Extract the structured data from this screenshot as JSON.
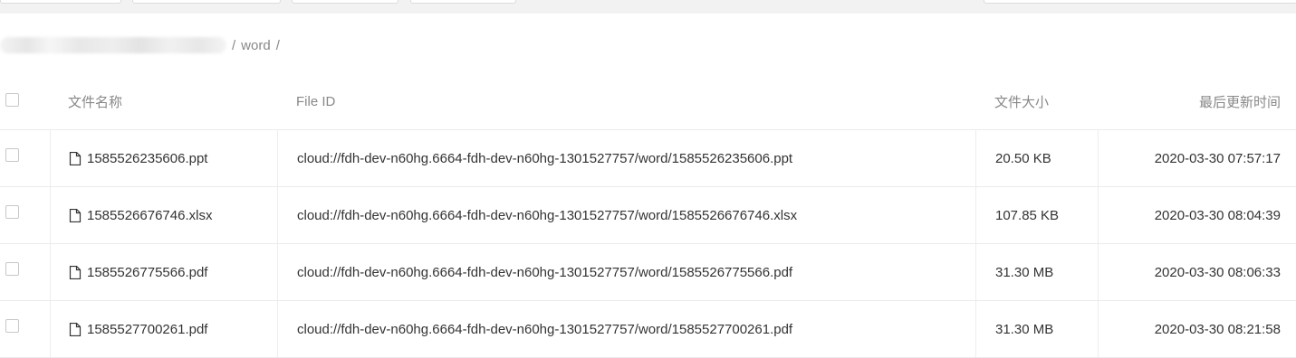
{
  "breadcrumb": {
    "separator": "/",
    "current": "word"
  },
  "table": {
    "columns": {
      "name": "文件名称",
      "id": "File ID",
      "size": "文件大小",
      "time": "最后更新时间"
    },
    "rows": [
      {
        "name": "1585526235606.ppt",
        "id": "cloud://fdh-dev-n60hg.6664-fdh-dev-n60hg-1301527757/word/1585526235606.ppt",
        "size": "20.50 KB",
        "time": "2020-03-30 07:57:17"
      },
      {
        "name": "1585526676746.xlsx",
        "id": "cloud://fdh-dev-n60hg.6664-fdh-dev-n60hg-1301527757/word/1585526676746.xlsx",
        "size": "107.85 KB",
        "time": "2020-03-30 08:04:39"
      },
      {
        "name": "1585526775566.pdf",
        "id": "cloud://fdh-dev-n60hg.6664-fdh-dev-n60hg-1301527757/word/1585526775566.pdf",
        "size": "31.30 MB",
        "time": "2020-03-30 08:06:33"
      },
      {
        "name": "1585527700261.pdf",
        "id": "cloud://fdh-dev-n60hg.6664-fdh-dev-n60hg-1301527757/word/1585527700261.pdf",
        "size": "31.30 MB",
        "time": "2020-03-30 08:21:58"
      }
    ]
  },
  "icons": {
    "file": "file-icon"
  }
}
